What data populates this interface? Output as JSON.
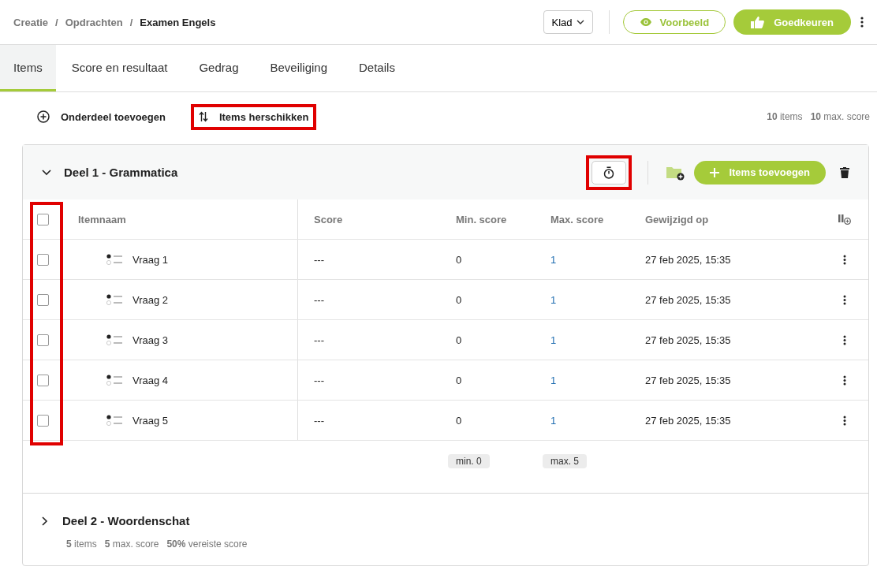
{
  "breadcrumb": {
    "items": [
      "Creatie",
      "Opdrachten",
      "Examen Engels"
    ],
    "separator": "/"
  },
  "header": {
    "status_dropdown": "Klad",
    "preview_button": "Voorbeeld",
    "approve_button": "Goedkeuren"
  },
  "tabs": [
    {
      "label": "Items",
      "selected": true
    },
    {
      "label": "Score en resultaat",
      "selected": false
    },
    {
      "label": "Gedrag",
      "selected": false
    },
    {
      "label": "Beveiliging",
      "selected": false
    },
    {
      "label": "Details",
      "selected": false
    }
  ],
  "toolbar": {
    "add_section": {
      "label": "Onderdeel toevoegen",
      "highlighted": false
    },
    "reorder": {
      "label": "Items herschikken",
      "highlighted": true
    },
    "summary": [
      "**10** items",
      "**10** max. score"
    ]
  },
  "sections": [
    {
      "title": "Deel 1 - Grammatica",
      "expanded": true,
      "timer_highlighted": true,
      "add_items_label": "Items toevoegen",
      "checkbox_column_highlighted": true,
      "columns": [
        "Itemnaam",
        "Score",
        "Min. score",
        "Max. score",
        "Gewijzigd op"
      ],
      "select_all_checked": false,
      "rows": [
        {
          "name": "Vraag 1",
          "score": "---",
          "min_score": "0",
          "max_score": "1",
          "modified": "27 feb 2025, 15:35",
          "checked": false
        },
        {
          "name": "Vraag 2",
          "score": "---",
          "min_score": "0",
          "max_score": "1",
          "modified": "27 feb 2025, 15:35",
          "checked": false
        },
        {
          "name": "Vraag 3",
          "score": "---",
          "min_score": "0",
          "max_score": "1",
          "modified": "27 feb 2025, 15:35",
          "checked": false
        },
        {
          "name": "Vraag 4",
          "score": "---",
          "min_score": "0",
          "max_score": "1",
          "modified": "27 feb 2025, 15:35",
          "checked": false
        },
        {
          "name": "Vraag 5",
          "score": "---",
          "min_score": "0",
          "max_score": "1",
          "modified": "27 feb 2025, 15:35",
          "checked": false
        }
      ],
      "totals": {
        "min": "min. 0",
        "max": "max. 5"
      }
    },
    {
      "title": "Deel 2 - Woordenschat",
      "expanded": false,
      "stats": [
        "**5** items",
        "**5** max. score",
        "**50%** vereiste score"
      ]
    }
  ]
}
